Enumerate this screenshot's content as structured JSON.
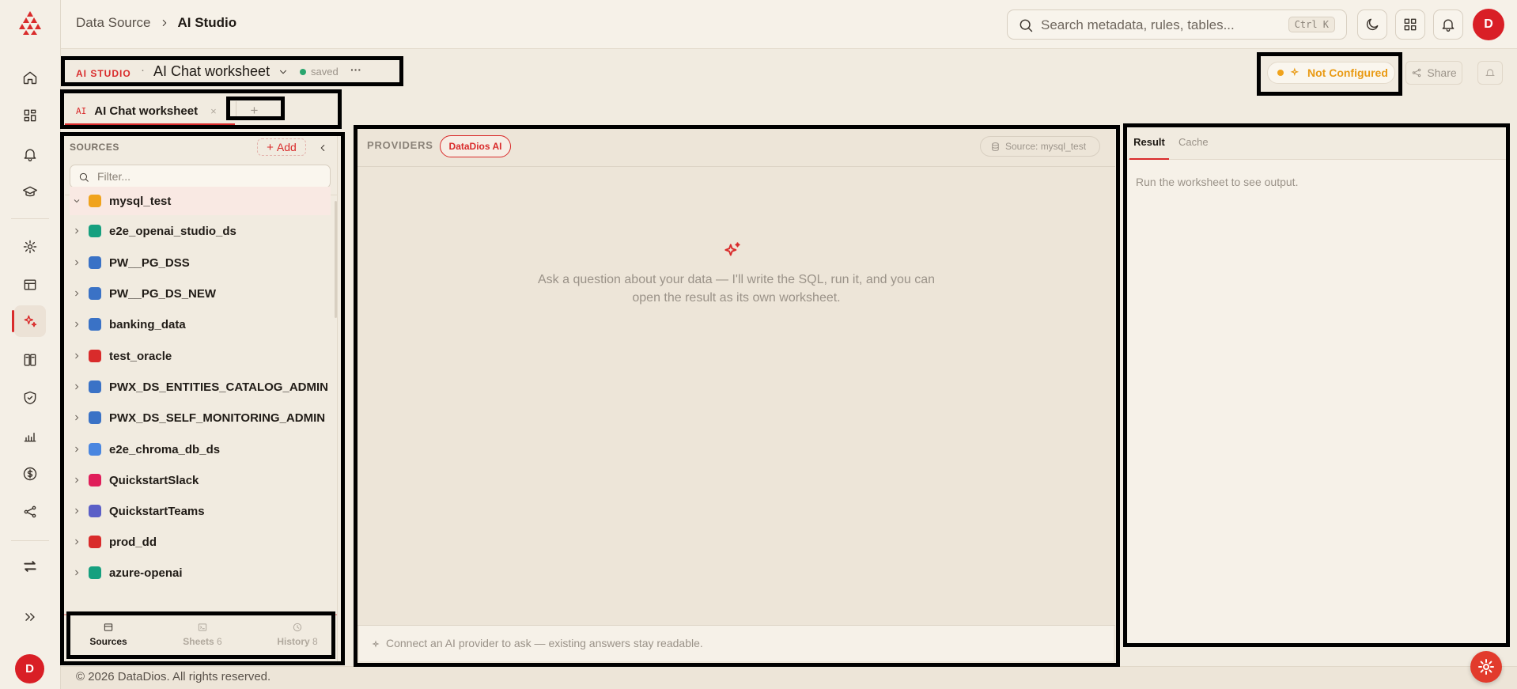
{
  "app": {
    "brand_color": "#d92b2b"
  },
  "rail": {
    "items": [
      {
        "icon": "home-icon"
      },
      {
        "icon": "dashboard-icon"
      },
      {
        "icon": "bell-icon"
      },
      {
        "icon": "graduation-cap-icon"
      },
      {
        "icon": "sun-icon"
      },
      {
        "icon": "table-icon"
      },
      {
        "icon": "sparkle-icon",
        "active": true
      },
      {
        "icon": "book-icon"
      },
      {
        "icon": "shield-check-icon"
      },
      {
        "icon": "chart-icon"
      },
      {
        "icon": "dollar-icon"
      },
      {
        "icon": "share-nodes-icon"
      },
      {
        "icon": "swap-icon"
      },
      {
        "icon": "expand-icon"
      }
    ],
    "avatar": "D"
  },
  "topbar": {
    "breadcrumb": [
      "Data Source",
      "AI Studio"
    ],
    "search_placeholder": "Search metadata, rules, tables...",
    "search_shortcut": "Ctrl K",
    "avatar": "D"
  },
  "header": {
    "tag": "AI STUDIO",
    "dot_sep": "·",
    "title": "AI Chat worksheet",
    "status": "saved",
    "more": "···",
    "status_button": "Not Configured",
    "share": "Share"
  },
  "tabs": [
    {
      "icon_text": "AI",
      "label": "AI Chat worksheet",
      "close": "×"
    }
  ],
  "tabs_add": "+",
  "sources": {
    "heading": "SOURCES",
    "add_label": "Add",
    "filter_placeholder": "Filter...",
    "items": [
      {
        "name": "mysql_test",
        "color": "#f0a31c",
        "expanded": true
      },
      {
        "name": "e2e_openai_studio_ds",
        "color": "#16a07f"
      },
      {
        "name": "PW__PG_DSS",
        "color": "#3a72c6"
      },
      {
        "name": "PW__PG_DS_NEW",
        "color": "#3a72c6"
      },
      {
        "name": "banking_data",
        "color": "#3a72c6"
      },
      {
        "name": "test_oracle",
        "color": "#d92b2b"
      },
      {
        "name": "PWX_DS_ENTITIES_CATALOG_ADMIN",
        "color": "#3a72c6"
      },
      {
        "name": "PWX_DS_SELF_MONITORING_ADMIN",
        "color": "#3a72c6"
      },
      {
        "name": "e2e_chroma_db_ds",
        "color": "#4a86e0"
      },
      {
        "name": "QuickstartSlack",
        "color": "#e01e5a"
      },
      {
        "name": "QuickstartTeams",
        "color": "#5b5fc7"
      },
      {
        "name": "prod_dd",
        "color": "#d92b2b"
      },
      {
        "name": "azure-openai",
        "color": "#16a07f"
      }
    ],
    "bottom_tabs": [
      {
        "label": "Sources",
        "count": ""
      },
      {
        "label": "Sheets",
        "count": "6"
      },
      {
        "label": "History",
        "count": "8"
      }
    ]
  },
  "chat": {
    "providers_label": "PROVIDERS",
    "provider": "DataDios AI",
    "source_chip": "Source: mysql_test",
    "empty_line1": "Ask a question about your data — I'll write the SQL, run it, and you can",
    "empty_line2": "open the result as its own worksheet.",
    "footer_note": "Connect an AI provider to ask — existing answers stay readable."
  },
  "result": {
    "tabs": [
      "Result",
      "Cache"
    ],
    "empty": "Run the worksheet to see output."
  },
  "footer": {
    "copyright": "© 2026 DataDios. All rights reserved."
  }
}
